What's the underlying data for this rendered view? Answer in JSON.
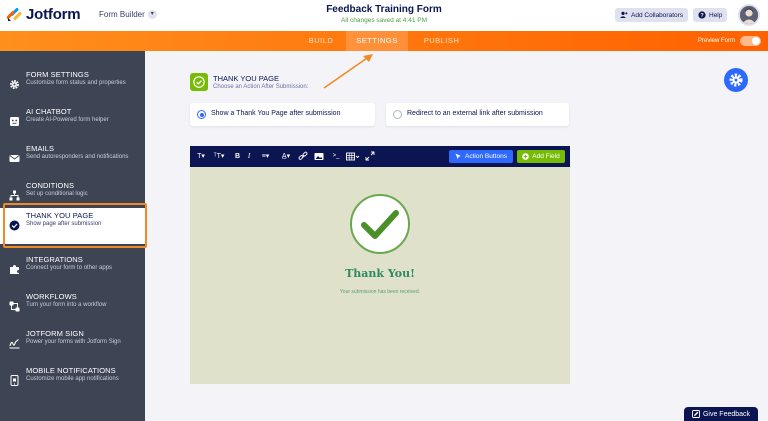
{
  "header": {
    "logo_text": "Jotform",
    "form_builder": "Form Builder",
    "form_title": "Feedback Training Form",
    "saved_status": "All changes saved at 4:41 PM",
    "add_collaborators": "Add Collaborators",
    "help": "Help"
  },
  "nav": {
    "tabs": [
      {
        "label": "BUILD"
      },
      {
        "label": "SETTINGS"
      },
      {
        "label": "PUBLISH"
      }
    ],
    "active_tab": "SETTINGS",
    "preview_form": "Preview Form",
    "preview_on": true
  },
  "sidebar": {
    "items": [
      {
        "title": "FORM SETTINGS",
        "subtitle": "Customize form status and properties",
        "icon": "gear-icon"
      },
      {
        "title": "AI CHATBOT",
        "subtitle": "Create AI-Powered form helper",
        "icon": "chatbot-icon"
      },
      {
        "title": "EMAILS",
        "subtitle": "Send autoresponders and notifications",
        "icon": "envelope-icon"
      },
      {
        "title": "CONDITIONS",
        "subtitle": "Set up conditional logic",
        "icon": "conditions-icon"
      },
      {
        "title": "THANK YOU PAGE",
        "subtitle": "Show page after submission",
        "icon": "check-circle-icon"
      },
      {
        "title": "INTEGRATIONS",
        "subtitle": "Connect your form to other apps",
        "icon": "puzzle-icon"
      },
      {
        "title": "WORKFLOWS",
        "subtitle": "Turn your form into a workflow",
        "icon": "workflow-icon"
      },
      {
        "title": "JOTFORM SIGN",
        "subtitle": "Power your forms with Jotform Sign",
        "icon": "signature-icon"
      },
      {
        "title": "MOBILE NOTIFICATIONS",
        "subtitle": "Customize mobile app notifications",
        "icon": "mobile-icon"
      }
    ],
    "active_index": 4
  },
  "thank_you": {
    "title": "THANK YOU PAGE",
    "subtitle": "Choose an Action After Submission:",
    "option_show": "Show a Thank You Page after submission",
    "option_redirect": "Redirect to an external link after submission",
    "selected": "show"
  },
  "editor": {
    "action_buttons": "Action Buttons",
    "add_field": "Add Field",
    "heading": "Thank You!",
    "message": "Your submission has been received."
  },
  "footer": {
    "give_feedback": "Give Feedback"
  },
  "colors": {
    "accent_orange": "#ff6100",
    "nav_dark": "#0a1551",
    "sidebar_bg": "#3d4555",
    "success_green": "#78bb07",
    "primary_blue": "#2e69ff",
    "thank_you_text": "#2d8a63"
  }
}
